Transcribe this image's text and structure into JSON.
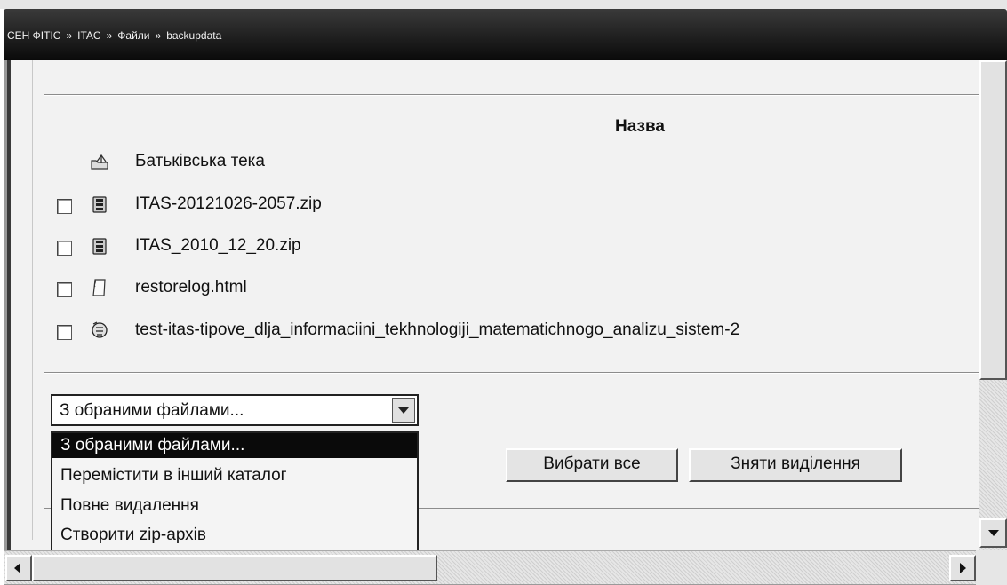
{
  "breadcrumb": {
    "items": [
      "СЕН ФІТІС",
      "ITAC",
      "Файли",
      "backupdata"
    ],
    "separator": "»"
  },
  "table": {
    "column_header": "Назва",
    "parent_folder": {
      "label": "Батьківська тека",
      "icon": "parent-folder-icon"
    },
    "rows": [
      {
        "name": "ITAS-20121026-2057.zip",
        "icon": "zip-archive-icon",
        "checked": false
      },
      {
        "name": "ITAS_2010_12_20.zip",
        "icon": "zip-archive-icon",
        "checked": false
      },
      {
        "name": "restorelog.html",
        "icon": "document-icon",
        "checked": false
      },
      {
        "name": "test-itas-tipove_dlja_informaciini_tekhnologiji_matematichnogo_analizu_sistem-2",
        "icon": "backup-file-icon",
        "checked": false
      }
    ]
  },
  "actions": {
    "select_value": "З обраними файлами...",
    "options": [
      "З обраними файлами...",
      "Перемістити в інший каталог",
      "Повне видалення",
      "Створити zip-архів"
    ],
    "selected_index": 0,
    "select_all_label": "Вибрати все",
    "deselect_label": "Зняти виділення"
  },
  "colors": {
    "navbar": "#0a0a0a",
    "content_bg": "#f2f2f2",
    "selection": "#0a0a0a"
  }
}
